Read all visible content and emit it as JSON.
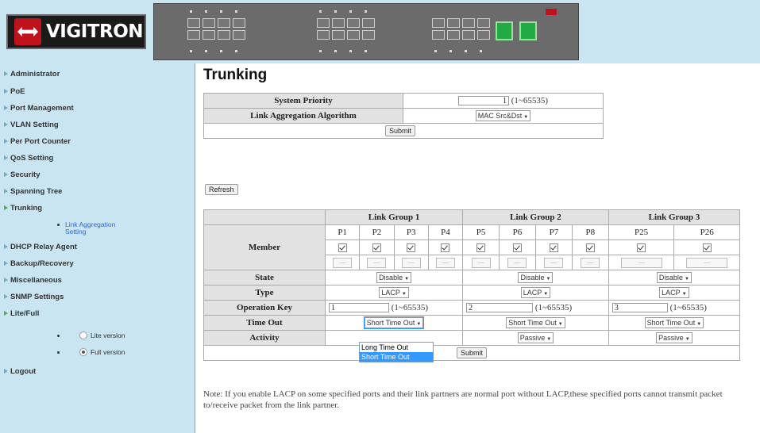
{
  "header": {
    "logo_text": "VIGITRON",
    "logo_icon": "vigitron-arrow-logo",
    "colors": {
      "header_bg": "#c9e5f1",
      "logo_red": "#c0121c"
    }
  },
  "sidebar": {
    "items": [
      {
        "label": "Administrator"
      },
      {
        "label": "PoE"
      },
      {
        "label": "Port Management"
      },
      {
        "label": "VLAN Setting"
      },
      {
        "label": "Per Port Counter"
      },
      {
        "label": "QoS Setting"
      },
      {
        "label": "Security"
      },
      {
        "label": "Spanning Tree"
      },
      {
        "label": "Trunking"
      },
      {
        "label": "DHCP Relay Agent"
      },
      {
        "label": "Backup/Recovery"
      },
      {
        "label": "Miscellaneous"
      },
      {
        "label": "SNMP Settings"
      },
      {
        "label": "Lite/Full"
      },
      {
        "label": "Logout"
      }
    ],
    "trunking_sub": "Link Aggregation Setting",
    "mode_options": [
      {
        "label": "Lite version",
        "selected": false
      },
      {
        "label": "Full version",
        "selected": true
      }
    ]
  },
  "main": {
    "title": "Trunking",
    "system_priority_label": "System Priority",
    "system_priority_value": "1",
    "system_priority_range": "(1~65535)",
    "algorithm_label": "Link Aggregation Algorithm",
    "algorithm_value": "MAC Src&Dst",
    "submit_label": "Submit",
    "refresh_label": "Refresh",
    "groups": [
      {
        "name": "Link Group 1",
        "ports": [
          "P1",
          "P2",
          "P3",
          "P4"
        ],
        "state": "Disable",
        "type": "LACP",
        "key": "1",
        "key_range": "(1~65535)",
        "timeout": "Short Time Out",
        "activity": ""
      },
      {
        "name": "Link Group 2",
        "ports": [
          "P5",
          "P6",
          "P7",
          "P8"
        ],
        "state": "Disable",
        "type": "LACP",
        "key": "2",
        "key_range": "(1~65535)",
        "timeout": "Short Time Out",
        "activity": "Passive"
      },
      {
        "name": "Link Group 3",
        "ports": [
          "P25",
          "P26"
        ],
        "state": "Disable",
        "type": "LACP",
        "key": "3",
        "key_range": "(1~65535)",
        "timeout": "Short Time Out",
        "activity": "Passive"
      }
    ],
    "row_labels": {
      "member": "Member",
      "state": "State",
      "type": "Type",
      "key": "Operation Key",
      "timeout": "Time Out",
      "activity": "Activity"
    },
    "dash": "—",
    "timeout_dropdown": {
      "options": [
        "Long Time Out",
        "Short Time Out"
      ],
      "highlighted": "Short Time Out"
    },
    "note": "Note: If you enable LACP on some specified ports and their link partners are normal port without LACP,these specified ports cannot transmit packet to/receive packet from the link partner."
  }
}
